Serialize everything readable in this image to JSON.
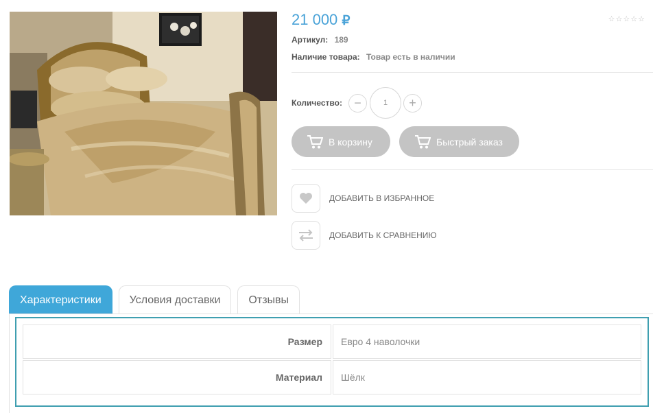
{
  "product": {
    "price": "21 000",
    "currency": "₽",
    "sku_label": "Артикул:",
    "sku_value": "189",
    "availability_label": "Наличие товара:",
    "availability_value": "Товар есть в наличии",
    "rating_stars": 0,
    "rating_max": 5
  },
  "purchase": {
    "quantity_label": "Количество:",
    "quantity_value": "1",
    "decrement_icon": "minus-icon",
    "increment_icon": "plus-icon",
    "add_to_cart_label": "В корзину",
    "quick_order_label": "Быстрый заказ",
    "cart_icon": "cart-icon"
  },
  "actions": {
    "favorite_label": "ДОБАВИТЬ В ИЗБРАННОЕ",
    "favorite_icon": "heart-icon",
    "compare_label": "ДОБАВИТЬ К СРАВНЕНИЮ",
    "compare_icon": "compare-arrows-icon"
  },
  "tabs": [
    {
      "label": "Характеристики",
      "active": true
    },
    {
      "label": "Условия доставки",
      "active": false
    },
    {
      "label": "Отзывы",
      "active": false
    }
  ],
  "specs": [
    {
      "key": "Размер",
      "value": "Евро 4 наволочки"
    },
    {
      "key": "Материал",
      "value": "Шёлк"
    }
  ],
  "colors": {
    "accent": "#3fa7d9",
    "price": "#4aa3d8",
    "button": "#c4c4c4",
    "panel_border": "#3f9fb0"
  }
}
